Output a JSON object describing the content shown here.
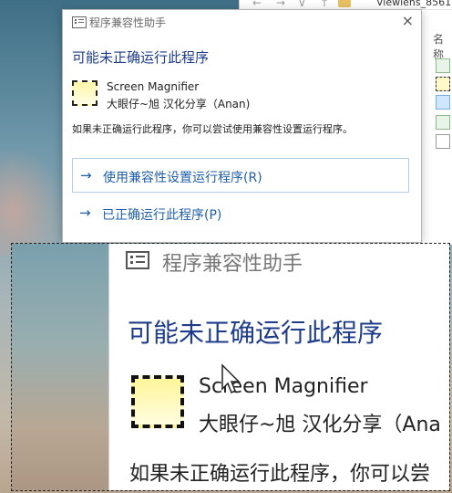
{
  "explorer": {
    "path": "Viewlens_8561",
    "column_header": "名称",
    "nav_buttons": [
      "←",
      "→",
      "∨",
      "↑"
    ],
    "file_icons": [
      "exe-icon",
      "dashed-icon",
      "selected-icon",
      "exe-icon",
      "text-file-icon"
    ]
  },
  "dialog": {
    "title": "程序兼容性助手",
    "close_glyph": "×",
    "heading": "可能未正确运行此程序",
    "app_name": "Screen Magnifier",
    "app_publisher": "大眼仔~旭 汉化分享（Anan)",
    "description": "如果未正确运行此程序，你可以尝试使用兼容性设置运行程序。",
    "options": [
      {
        "arrow": "→",
        "label": "使用兼容性设置运行程序(R)"
      },
      {
        "arrow": "→",
        "label": "已正确运行此程序(P)"
      }
    ]
  },
  "magnifier": {
    "title": "程序兼容性助手",
    "heading": "可能未正确运行此程序",
    "app_name": "Screen Magnifier",
    "app_publisher": "大眼仔~旭 汉化分享（Ana",
    "description": "如果未正确运行此程序，你可以尝"
  },
  "colors": {
    "link": "#1f5faa",
    "heading": "#1f3c8a",
    "option_border": "#b9cbe0"
  }
}
